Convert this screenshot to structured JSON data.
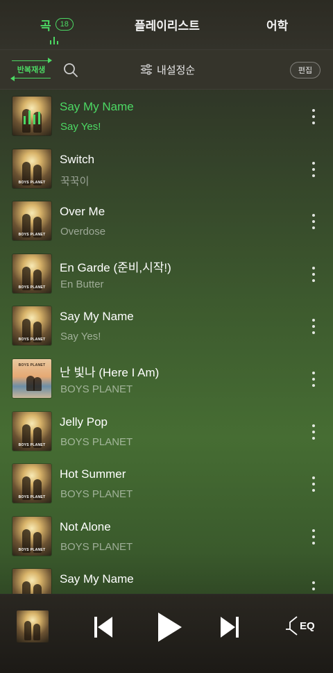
{
  "tabs": {
    "song": "곡",
    "song_count": "18",
    "playlist": "플레이리스트",
    "lang": "어학"
  },
  "toolbar": {
    "repeat_label": "반복재생",
    "sort_label": "내설정순",
    "edit_label": "편집"
  },
  "songs": [
    {
      "title": "Say My Name",
      "artist": "Say Yes!",
      "playing": true
    },
    {
      "title": "Switch",
      "artist": "꾹꾹이"
    },
    {
      "title": "Over Me",
      "artist": "Overdose"
    },
    {
      "title": "En Garde (준비,시작!)",
      "artist": "En Butter"
    },
    {
      "title": "Say My Name",
      "artist": "Say Yes!"
    },
    {
      "title": "난 빛나 (Here I Am)",
      "artist": "BOYS PLANET"
    },
    {
      "title": "Jelly Pop",
      "artist": "BOYS PLANET"
    },
    {
      "title": "Hot Summer",
      "artist": "BOYS PLANET"
    },
    {
      "title": "Not Alone",
      "artist": "BOYS PLANET"
    },
    {
      "title": "Say My Name",
      "artist": ""
    }
  ],
  "album_logo": "BOYS PLANET",
  "player": {
    "eq_label": "EQ"
  },
  "colors": {
    "accent": "#4cd964"
  }
}
